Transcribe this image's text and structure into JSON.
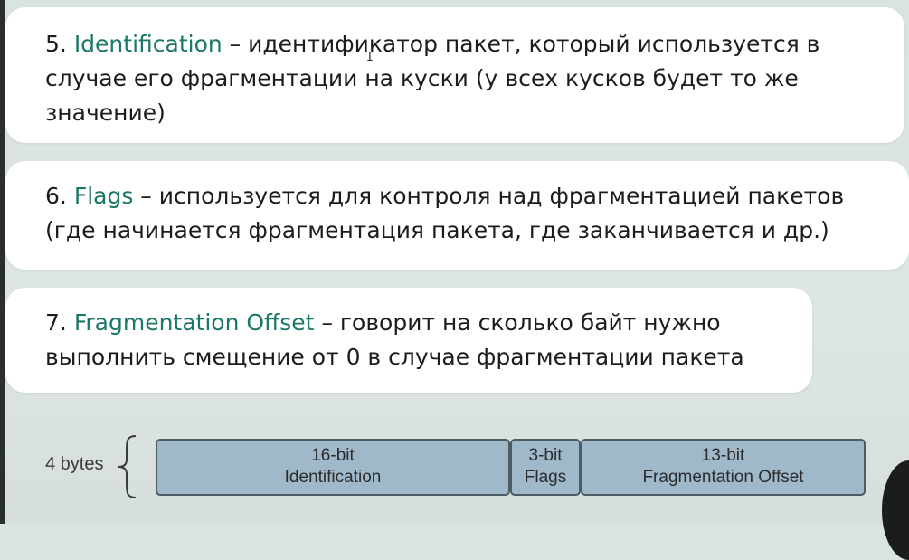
{
  "cards": [
    {
      "number": "5.",
      "term": "Identification",
      "text": " – идентификатор пакет, который используется в случае его фрагментации на куски (у всех кусков будет то же значение)"
    },
    {
      "number": "6.",
      "term": "Flags",
      "text": " – используется для контроля над фрагментацией пакетов (где начинается фрагментация пакета, где заканчивается и др.)"
    },
    {
      "number": "7.",
      "term": "Fragmentation Offset",
      "text": " – говорит на сколько байт нужно выполнить смещение от 0 в случае фрагментации пакета"
    }
  ],
  "diagram": {
    "bytes_label": "4 bytes",
    "fields": [
      {
        "bits": "16-bit",
        "name": "Identification"
      },
      {
        "bits": "3-bit",
        "name": "Flags"
      },
      {
        "bits": "13-bit",
        "name": "Fragmentation Offset"
      }
    ]
  },
  "colors": {
    "term": "#1b7768",
    "field_fill": "#9fb8ca",
    "field_border": "#4f5b63",
    "background": "#dde6e2"
  }
}
